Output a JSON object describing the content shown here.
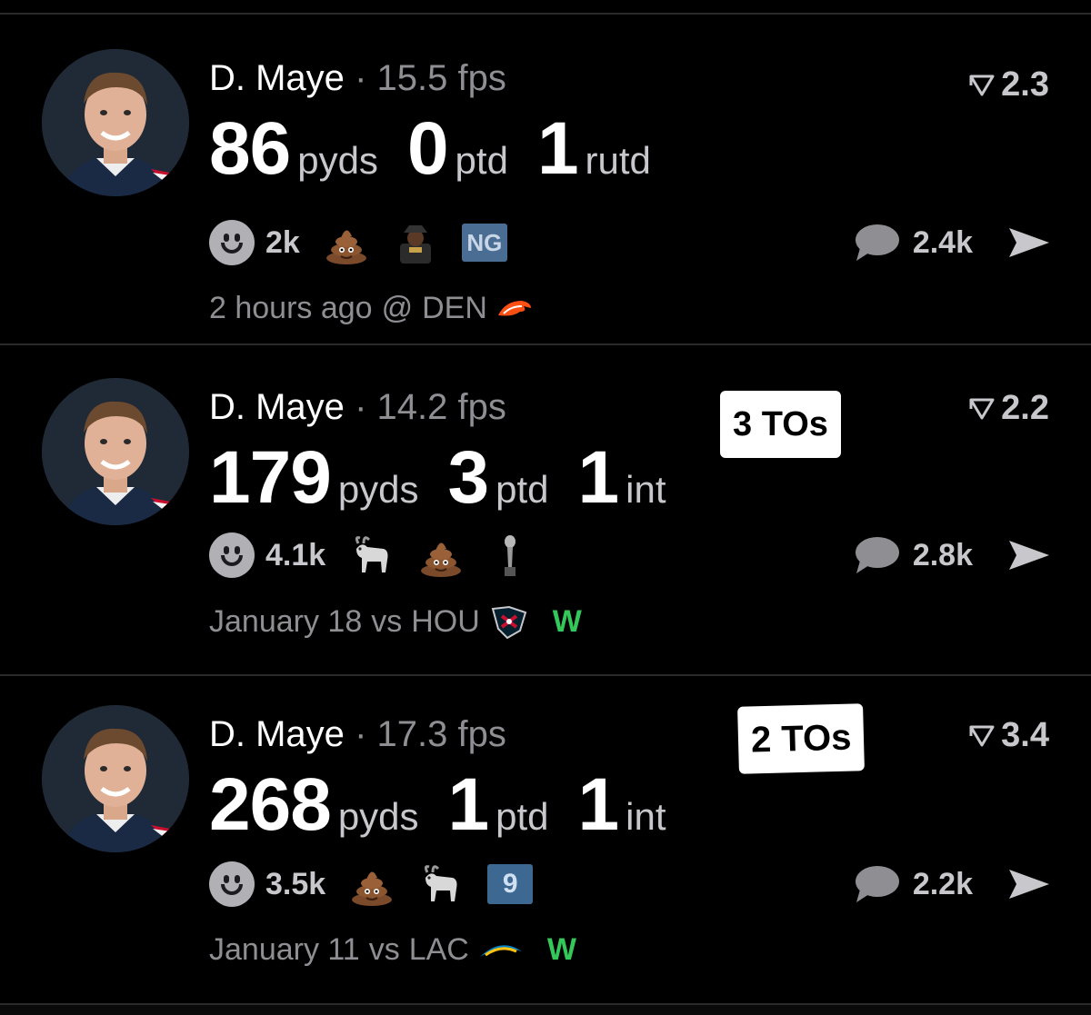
{
  "colors": {
    "background": "#000000",
    "win": "#34c759",
    "muted": "#8e8e93",
    "divider": "#2a2a2c"
  },
  "cards": [
    {
      "player": "D. Maye",
      "separator": "·",
      "fps": "15.5 fps",
      "rating": "2.3",
      "rating_icon": "triangle-flag-icon",
      "stats": [
        {
          "value": "86",
          "unit": "pyds"
        },
        {
          "value": "0",
          "unit": "ptd"
        },
        {
          "value": "1",
          "unit": "rutd"
        }
      ],
      "turnovers": "",
      "reactions": {
        "count": "2k",
        "icons": [
          "smiley-icon",
          "poop-emoji-icon",
          "person-sticker-icon",
          "ng-badge-icon"
        ],
        "ng_label": "NG"
      },
      "comment_count": "2.4k",
      "date": "2 hours ago",
      "venue": "@",
      "opponent": "DEN",
      "opponent_icon": "broncos-logo-icon",
      "result": ""
    },
    {
      "player": "D. Maye",
      "separator": "·",
      "fps": "14.2 fps",
      "rating": "2.2",
      "rating_icon": "triangle-flag-icon",
      "stats": [
        {
          "value": "179",
          "unit": "pyds"
        },
        {
          "value": "3",
          "unit": "ptd"
        },
        {
          "value": "1",
          "unit": "int"
        }
      ],
      "turnovers": "3 TOs",
      "reactions": {
        "count": "4.1k",
        "icons": [
          "smiley-icon",
          "goat-emoji-icon",
          "poop-emoji-icon",
          "trophy-icon"
        ]
      },
      "comment_count": "2.8k",
      "date": "January 18",
      "venue": "vs",
      "opponent": "HOU",
      "opponent_icon": "texans-logo-icon",
      "result": "W"
    },
    {
      "player": "D. Maye",
      "separator": "·",
      "fps": "17.3 fps",
      "rating": "3.4",
      "rating_icon": "triangle-flag-icon",
      "stats": [
        {
          "value": "268",
          "unit": "pyds"
        },
        {
          "value": "1",
          "unit": "ptd"
        },
        {
          "value": "1",
          "unit": "int"
        }
      ],
      "turnovers": "2 TOs",
      "reactions": {
        "count": "3.5k",
        "icons": [
          "smiley-icon",
          "poop-emoji-icon",
          "goat-emoji-icon",
          "nine-badge-icon"
        ],
        "nine_label": "9"
      },
      "comment_count": "2.2k",
      "date": "January 11",
      "venue": "vs",
      "opponent": "LAC",
      "opponent_icon": "chargers-logo-icon",
      "result": "W"
    }
  ]
}
